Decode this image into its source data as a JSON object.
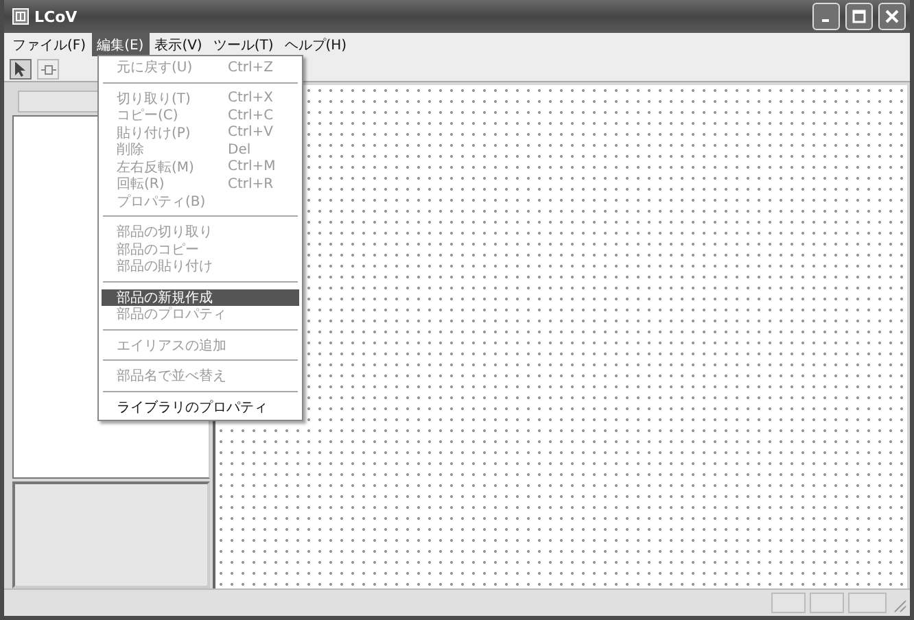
{
  "window": {
    "title": "LCoV"
  },
  "menu_bar": [
    {
      "label": "ファイル(F)",
      "selected": false
    },
    {
      "label": "編集(E)",
      "selected": true
    },
    {
      "label": "表示(V)",
      "selected": false
    },
    {
      "label": "ツール(T)",
      "selected": false
    },
    {
      "label": "ヘルプ(H)",
      "selected": false
    }
  ],
  "toolbar": [
    {
      "kind": "pointer",
      "pressed": true
    },
    {
      "kind": "wire",
      "pressed": false
    }
  ],
  "edit_menu": {
    "groups": [
      [
        {
          "label": "元に戻す(U)",
          "shortcut": "Ctrl+Z",
          "disabled": true,
          "selected": false
        }
      ],
      [
        {
          "label": "切り取り(T)",
          "shortcut": "Ctrl+X",
          "disabled": true,
          "selected": false
        },
        {
          "label": "コピー(C)",
          "shortcut": "Ctrl+C",
          "disabled": true,
          "selected": false
        },
        {
          "label": "貼り付け(P)",
          "shortcut": "Ctrl+V",
          "disabled": true,
          "selected": false
        },
        {
          "label": "削除",
          "shortcut": "Del",
          "disabled": true,
          "selected": false
        },
        {
          "label": "左右反転(M)",
          "shortcut": "Ctrl+M",
          "disabled": true,
          "selected": false
        },
        {
          "label": "回転(R)",
          "shortcut": "Ctrl+R",
          "disabled": true,
          "selected": false
        },
        {
          "label": "プロパティ(B)",
          "disabled": true,
          "selected": false
        }
      ],
      [
        {
          "label": "部品の切り取り",
          "disabled": true,
          "selected": false
        },
        {
          "label": "部品のコピー",
          "disabled": true,
          "selected": false
        },
        {
          "label": "部品の貼り付け",
          "disabled": true,
          "selected": false
        }
      ],
      [
        {
          "label": "部品の新規作成",
          "disabled": false,
          "selected": true
        },
        {
          "label": "部品のプロパティ",
          "disabled": true,
          "selected": false
        }
      ],
      [
        {
          "label": "エイリアスの追加",
          "disabled": true,
          "selected": false
        }
      ],
      [
        {
          "label": "部品名で並べ替え",
          "disabled": true,
          "selected": false
        }
      ],
      [
        {
          "label": "ライブラリのプロパティ",
          "disabled": false,
          "selected": false
        }
      ]
    ]
  }
}
